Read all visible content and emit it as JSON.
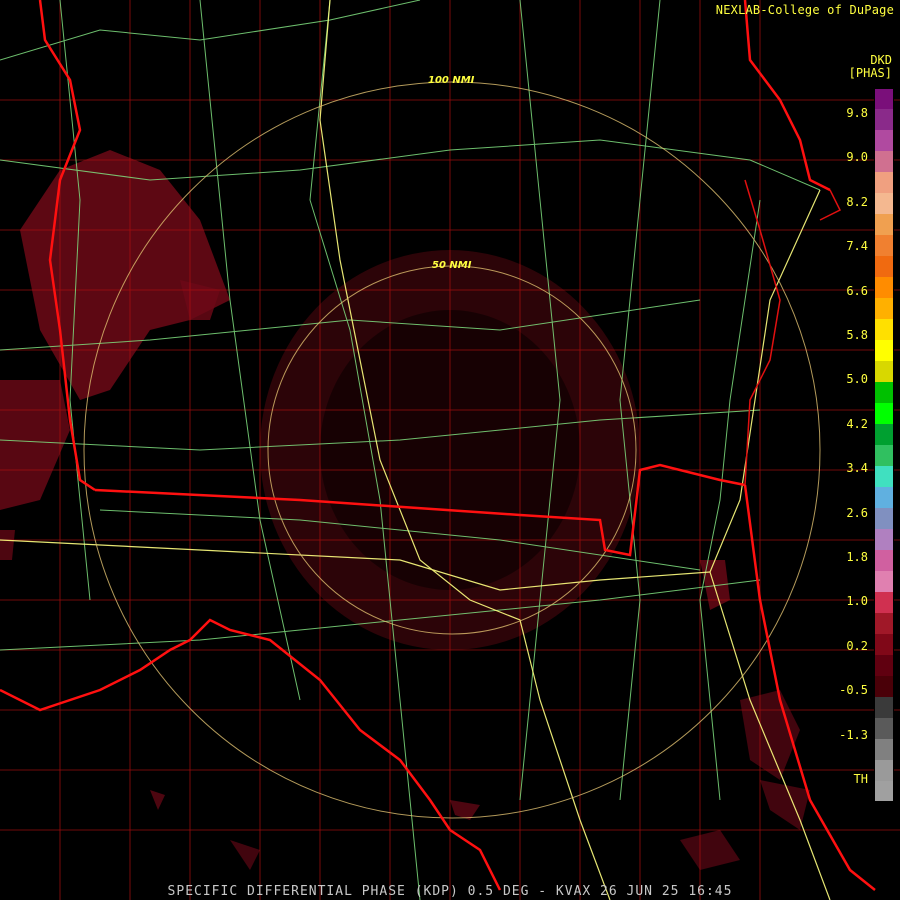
{
  "credit": "NEXLAB-College of DuPage",
  "legend": {
    "units_line1": "DKD",
    "units_line2": "[PHAS]",
    "ticks": [
      "9.8",
      "9.0",
      "8.2",
      "7.4",
      "6.6",
      "5.8",
      "5.0",
      "4.2",
      "3.4",
      "2.6",
      "1.8",
      "1.0",
      "0.2",
      "-0.5",
      "-1.3",
      "TH"
    ],
    "colors": [
      "#7a0f7a",
      "#8a2a8a",
      "#b04aa0",
      "#d07090",
      "#f0a080",
      "#f4b890",
      "#f0a050",
      "#f08030",
      "#f06a10",
      "#ff8c00",
      "#ffb000",
      "#ffe000",
      "#ffff00",
      "#d8d800",
      "#00c000",
      "#00ff00",
      "#00a030",
      "#30c060",
      "#40e0c0",
      "#60b0e0",
      "#8090c0",
      "#b080c0",
      "#d060a0",
      "#e080b0",
      "#d03050",
      "#a01828",
      "#800818",
      "#600010",
      "#4a0008",
      "#3a3a3a",
      "#5a5a5a",
      "#808080",
      "#9a9a9a",
      "#a0a0a0"
    ]
  },
  "range_rings": {
    "outer_label": "100 NMI",
    "inner_label": "50 NMI"
  },
  "caption": "SPECIFIC DIFFERENTIAL PHASE (KDP) 0.5 DEG - KVAX 26 JUN 25 16:45",
  "colors": {
    "state_border": "#ff1010",
    "county_border": "#c01010",
    "highway": "#80e080",
    "interstate": "#ffff80",
    "ring": "#e0c070",
    "precip": "#7a0a1a"
  }
}
